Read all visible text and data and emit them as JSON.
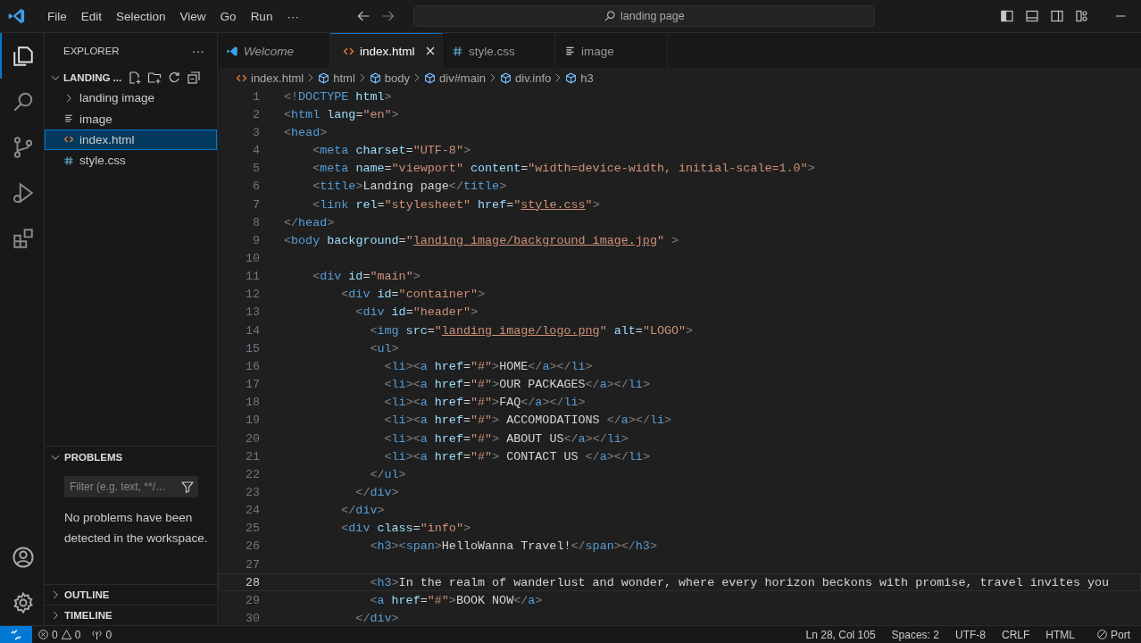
{
  "title_bar": {
    "menu": [
      "File",
      "Edit",
      "Selection",
      "View",
      "Go",
      "Run",
      "···"
    ],
    "search": {
      "value": "landing page"
    }
  },
  "activity_bar": [
    {
      "kind": "explorer",
      "selected": true
    },
    {
      "kind": "search",
      "selected": false
    },
    {
      "kind": "source-control",
      "selected": false
    },
    {
      "kind": "run",
      "selected": false
    },
    {
      "kind": "extensions",
      "selected": false
    }
  ],
  "activity_bar_bottom": [
    {
      "kind": "account"
    },
    {
      "kind": "settings"
    }
  ],
  "sidebar": {
    "title": "EXPLORER",
    "more": "···",
    "folder": {
      "name": "LANDING ...",
      "expanded": true,
      "items": [
        {
          "kind": "folder",
          "name": "landing image",
          "expanded": false,
          "selected": false
        },
        {
          "kind": "text",
          "name": "image",
          "selected": false
        },
        {
          "kind": "html",
          "name": "index.html",
          "selected": true
        },
        {
          "kind": "css",
          "name": "style.css",
          "selected": false
        }
      ]
    },
    "problems": {
      "title": "PROBLEMS",
      "expanded": true,
      "filter": {
        "placeholder": "Filter (e.g. text, **/…"
      },
      "message": "No problems have been detected in the workspace."
    },
    "sections": [
      {
        "title": "OUTLINE",
        "expanded": false
      },
      {
        "title": "TIMELINE",
        "expanded": false
      }
    ]
  },
  "tabs": [
    {
      "kind": "welcome",
      "label": "Welcome",
      "preview": true,
      "selected": false
    },
    {
      "kind": "html",
      "label": "index.html",
      "preview": false,
      "selected": true
    },
    {
      "kind": "css",
      "label": "style.css",
      "preview": false,
      "selected": false
    },
    {
      "kind": "text",
      "label": "image",
      "preview": false,
      "selected": false
    }
  ],
  "breadcrumbs": [
    {
      "kind": "file",
      "label": "index.html"
    },
    {
      "kind": "element",
      "label": "html"
    },
    {
      "kind": "element",
      "label": "body"
    },
    {
      "kind": "element",
      "label": "div#main"
    },
    {
      "kind": "element",
      "label": "div.info"
    },
    {
      "kind": "element",
      "label": "h3"
    }
  ],
  "editor": {
    "lines": [
      {
        "number": "1",
        "current": false,
        "tokens": [
          {
            "kind": "bracket",
            "text": "<!"
          },
          {
            "kind": "tag",
            "text": "DOCTYPE"
          },
          {
            "kind": "attr",
            "text": " html"
          },
          {
            "kind": "bracket",
            "text": ">"
          }
        ]
      },
      {
        "number": "2",
        "current": false,
        "tokens": [
          {
            "kind": "bracket",
            "text": "<"
          },
          {
            "kind": "tag",
            "text": "html"
          },
          {
            "kind": "attr",
            "text": " lang"
          },
          {
            "kind": "punct",
            "text": "="
          },
          {
            "kind": "string",
            "text": "\"en\""
          },
          {
            "kind": "bracket",
            "text": ">"
          }
        ]
      },
      {
        "number": "3",
        "current": false,
        "tokens": [
          {
            "kind": "bracket",
            "text": "<"
          },
          {
            "kind": "tag",
            "text": "head"
          },
          {
            "kind": "bracket",
            "text": ">"
          }
        ]
      },
      {
        "number": "4",
        "current": false,
        "tokens": [
          {
            "kind": "bracket",
            "text": "    <"
          },
          {
            "kind": "tag",
            "text": "meta"
          },
          {
            "kind": "attr",
            "text": " charset"
          },
          {
            "kind": "punct",
            "text": "="
          },
          {
            "kind": "string",
            "text": "\"UTF-8\""
          },
          {
            "kind": "bracket",
            "text": ">"
          }
        ]
      },
      {
        "number": "5",
        "current": false,
        "tokens": [
          {
            "kind": "bracket",
            "text": "    <"
          },
          {
            "kind": "tag",
            "text": "meta"
          },
          {
            "kind": "attr",
            "text": " name"
          },
          {
            "kind": "punct",
            "text": "="
          },
          {
            "kind": "string",
            "text": "\"viewport\""
          },
          {
            "kind": "attr",
            "text": " content"
          },
          {
            "kind": "punct",
            "text": "="
          },
          {
            "kind": "string",
            "text": "\"width=device-width, initial-scale=1.0\""
          },
          {
            "kind": "bracket",
            "text": ">"
          }
        ]
      },
      {
        "number": "6",
        "current": false,
        "tokens": [
          {
            "kind": "bracket",
            "text": "    <"
          },
          {
            "kind": "tag",
            "text": "title"
          },
          {
            "kind": "bracket",
            "text": ">"
          },
          {
            "kind": "text",
            "text": "Landing page"
          },
          {
            "kind": "bracket",
            "text": "</"
          },
          {
            "kind": "tag",
            "text": "title"
          },
          {
            "kind": "bracket",
            "text": ">"
          }
        ]
      },
      {
        "number": "7",
        "current": false,
        "tokens": [
          {
            "kind": "bracket",
            "text": "    <"
          },
          {
            "kind": "tag",
            "text": "link"
          },
          {
            "kind": "attr",
            "text": " rel"
          },
          {
            "kind": "punct",
            "text": "="
          },
          {
            "kind": "string",
            "text": "\"stylesheet\""
          },
          {
            "kind": "attr",
            "text": " href"
          },
          {
            "kind": "punct",
            "text": "="
          },
          {
            "kind": "string",
            "text": "\""
          },
          {
            "kind": "link",
            "text": "style.css"
          },
          {
            "kind": "string",
            "text": "\""
          },
          {
            "kind": "bracket",
            "text": ">"
          }
        ]
      },
      {
        "number": "8",
        "current": false,
        "tokens": [
          {
            "kind": "bracket",
            "text": "</"
          },
          {
            "kind": "tag",
            "text": "head"
          },
          {
            "kind": "bracket",
            "text": ">"
          }
        ]
      },
      {
        "number": "9",
        "current": false,
        "tokens": [
          {
            "kind": "bracket",
            "text": "<"
          },
          {
            "kind": "tag",
            "text": "body"
          },
          {
            "kind": "attr",
            "text": " background"
          },
          {
            "kind": "punct",
            "text": "="
          },
          {
            "kind": "string",
            "text": "\""
          },
          {
            "kind": "link",
            "text": "landing image/background image.jpg"
          },
          {
            "kind": "string",
            "text": "\""
          },
          {
            "kind": "bracket",
            "text": " >"
          }
        ]
      },
      {
        "number": "10",
        "current": false
      },
      {
        "number": "11",
        "current": false,
        "tokens": [
          {
            "kind": "bracket",
            "text": "    <"
          },
          {
            "kind": "tag",
            "text": "div"
          },
          {
            "kind": "attr",
            "text": " id"
          },
          {
            "kind": "punct",
            "text": "="
          },
          {
            "kind": "string",
            "text": "\"main\""
          },
          {
            "kind": "bracket",
            "text": ">"
          }
        ]
      },
      {
        "number": "12",
        "current": false,
        "tokens": [
          {
            "kind": "bracket",
            "text": "        <"
          },
          {
            "kind": "tag",
            "text": "div"
          },
          {
            "kind": "attr",
            "text": " id"
          },
          {
            "kind": "punct",
            "text": "="
          },
          {
            "kind": "string",
            "text": "\"container\""
          },
          {
            "kind": "bracket",
            "text": ">"
          }
        ]
      },
      {
        "number": "13",
        "current": false,
        "tokens": [
          {
            "kind": "bracket",
            "text": "          <"
          },
          {
            "kind": "tag",
            "text": "div"
          },
          {
            "kind": "attr",
            "text": " id"
          },
          {
            "kind": "punct",
            "text": "="
          },
          {
            "kind": "string",
            "text": "\"header\""
          },
          {
            "kind": "bracket",
            "text": ">"
          }
        ]
      },
      {
        "number": "14",
        "current": false,
        "tokens": [
          {
            "kind": "bracket",
            "text": "            <"
          },
          {
            "kind": "tag",
            "text": "img"
          },
          {
            "kind": "attr",
            "text": " src"
          },
          {
            "kind": "punct",
            "text": "="
          },
          {
            "kind": "string",
            "text": "\""
          },
          {
            "kind": "link",
            "text": "landing image/logo.png"
          },
          {
            "kind": "string",
            "text": "\""
          },
          {
            "kind": "attr",
            "text": " alt"
          },
          {
            "kind": "punct",
            "text": "="
          },
          {
            "kind": "string",
            "text": "\"LOGO\""
          },
          {
            "kind": "bracket",
            "text": ">"
          }
        ]
      },
      {
        "number": "15",
        "current": false,
        "tokens": [
          {
            "kind": "bracket",
            "text": "            <"
          },
          {
            "kind": "tag",
            "text": "ul"
          },
          {
            "kind": "bracket",
            "text": ">"
          }
        ]
      },
      {
        "number": "16",
        "current": false,
        "tokens": [
          {
            "kind": "bracket",
            "text": "              <"
          },
          {
            "kind": "tag",
            "text": "li"
          },
          {
            "kind": "bracket",
            "text": "><"
          },
          {
            "kind": "tag",
            "text": "a"
          },
          {
            "kind": "attr",
            "text": " href"
          },
          {
            "kind": "punct",
            "text": "="
          },
          {
            "kind": "string",
            "text": "\"#\""
          },
          {
            "kind": "bracket",
            "text": ">"
          },
          {
            "kind": "text",
            "text": "HOME"
          },
          {
            "kind": "bracket",
            "text": "</"
          },
          {
            "kind": "tag",
            "text": "a"
          },
          {
            "kind": "bracket",
            "text": "></"
          },
          {
            "kind": "tag",
            "text": "li"
          },
          {
            "kind": "bracket",
            "text": ">"
          }
        ]
      },
      {
        "number": "17",
        "current": false,
        "tokens": [
          {
            "kind": "bracket",
            "text": "              <"
          },
          {
            "kind": "tag",
            "text": "li"
          },
          {
            "kind": "bracket",
            "text": "><"
          },
          {
            "kind": "tag",
            "text": "a"
          },
          {
            "kind": "attr",
            "text": " href"
          },
          {
            "kind": "punct",
            "text": "="
          },
          {
            "kind": "string",
            "text": "\"#\""
          },
          {
            "kind": "bracket",
            "text": ">"
          },
          {
            "kind": "text",
            "text": "OUR PACKAGES"
          },
          {
            "kind": "bracket",
            "text": "</"
          },
          {
            "kind": "tag",
            "text": "a"
          },
          {
            "kind": "bracket",
            "text": "></"
          },
          {
            "kind": "tag",
            "text": "li"
          },
          {
            "kind": "bracket",
            "text": ">"
          }
        ]
      },
      {
        "number": "18",
        "current": false,
        "tokens": [
          {
            "kind": "bracket",
            "text": "              <"
          },
          {
            "kind": "tag",
            "text": "li"
          },
          {
            "kind": "bracket",
            "text": "><"
          },
          {
            "kind": "tag",
            "text": "a"
          },
          {
            "kind": "attr",
            "text": " href"
          },
          {
            "kind": "punct",
            "text": "="
          },
          {
            "kind": "string",
            "text": "\"#\""
          },
          {
            "kind": "bracket",
            "text": ">"
          },
          {
            "kind": "text",
            "text": "FAQ"
          },
          {
            "kind": "bracket",
            "text": "</"
          },
          {
            "kind": "tag",
            "text": "a"
          },
          {
            "kind": "bracket",
            "text": "></"
          },
          {
            "kind": "tag",
            "text": "li"
          },
          {
            "kind": "bracket",
            "text": ">"
          }
        ]
      },
      {
        "number": "19",
        "current": false,
        "tokens": [
          {
            "kind": "bracket",
            "text": "              <"
          },
          {
            "kind": "tag",
            "text": "li"
          },
          {
            "kind": "bracket",
            "text": "><"
          },
          {
            "kind": "tag",
            "text": "a"
          },
          {
            "kind": "attr",
            "text": " href"
          },
          {
            "kind": "punct",
            "text": "="
          },
          {
            "kind": "string",
            "text": "\"#\""
          },
          {
            "kind": "bracket",
            "text": ">"
          },
          {
            "kind": "text",
            "text": " ACCOMODATIONS "
          },
          {
            "kind": "bracket",
            "text": "</"
          },
          {
            "kind": "tag",
            "text": "a"
          },
          {
            "kind": "bracket",
            "text": "></"
          },
          {
            "kind": "tag",
            "text": "li"
          },
          {
            "kind": "bracket",
            "text": ">"
          }
        ]
      },
      {
        "number": "20",
        "current": false,
        "tokens": [
          {
            "kind": "bracket",
            "text": "              <"
          },
          {
            "kind": "tag",
            "text": "li"
          },
          {
            "kind": "bracket",
            "text": "><"
          },
          {
            "kind": "tag",
            "text": "a"
          },
          {
            "kind": "attr",
            "text": " href"
          },
          {
            "kind": "punct",
            "text": "="
          },
          {
            "kind": "string",
            "text": "\"#\""
          },
          {
            "kind": "bracket",
            "text": ">"
          },
          {
            "kind": "text",
            "text": " ABOUT US"
          },
          {
            "kind": "bracket",
            "text": "</"
          },
          {
            "kind": "tag",
            "text": "a"
          },
          {
            "kind": "bracket",
            "text": "></"
          },
          {
            "kind": "tag",
            "text": "li"
          },
          {
            "kind": "bracket",
            "text": ">"
          }
        ]
      },
      {
        "number": "21",
        "current": false,
        "tokens": [
          {
            "kind": "bracket",
            "text": "              <"
          },
          {
            "kind": "tag",
            "text": "li"
          },
          {
            "kind": "bracket",
            "text": "><"
          },
          {
            "kind": "tag",
            "text": "a"
          },
          {
            "kind": "attr",
            "text": " href"
          },
          {
            "kind": "punct",
            "text": "="
          },
          {
            "kind": "string",
            "text": "\"#\""
          },
          {
            "kind": "bracket",
            "text": ">"
          },
          {
            "kind": "text",
            "text": " CONTACT US "
          },
          {
            "kind": "bracket",
            "text": "</"
          },
          {
            "kind": "tag",
            "text": "a"
          },
          {
            "kind": "bracket",
            "text": "></"
          },
          {
            "kind": "tag",
            "text": "li"
          },
          {
            "kind": "bracket",
            "text": ">"
          }
        ]
      },
      {
        "number": "22",
        "current": false,
        "tokens": [
          {
            "kind": "bracket",
            "text": "            </"
          },
          {
            "kind": "tag",
            "text": "ul"
          },
          {
            "kind": "bracket",
            "text": ">"
          }
        ]
      },
      {
        "number": "23",
        "current": false,
        "tokens": [
          {
            "kind": "bracket",
            "text": "          </"
          },
          {
            "kind": "tag",
            "text": "div"
          },
          {
            "kind": "bracket",
            "text": ">"
          }
        ]
      },
      {
        "number": "24",
        "current": false,
        "tokens": [
          {
            "kind": "bracket",
            "text": "        </"
          },
          {
            "kind": "tag",
            "text": "div"
          },
          {
            "kind": "bracket",
            "text": ">"
          }
        ]
      },
      {
        "number": "25",
        "current": false,
        "tokens": [
          {
            "kind": "bracket",
            "text": "        <"
          },
          {
            "kind": "tag",
            "text": "div"
          },
          {
            "kind": "attr",
            "text": " class"
          },
          {
            "kind": "punct",
            "text": "="
          },
          {
            "kind": "string",
            "text": "\"info\""
          },
          {
            "kind": "bracket",
            "text": ">"
          }
        ]
      },
      {
        "number": "26",
        "current": false,
        "tokens": [
          {
            "kind": "bracket",
            "text": "            <"
          },
          {
            "kind": "tag",
            "text": "h3"
          },
          {
            "kind": "bracket",
            "text": "><"
          },
          {
            "kind": "tag",
            "text": "span"
          },
          {
            "kind": "bracket",
            "text": ">"
          },
          {
            "kind": "text",
            "text": "HelloWanna Travel!"
          },
          {
            "kind": "bracket",
            "text": "</"
          },
          {
            "kind": "tag",
            "text": "span"
          },
          {
            "kind": "bracket",
            "text": "></"
          },
          {
            "kind": "tag",
            "text": "h3"
          },
          {
            "kind": "bracket",
            "text": ">"
          }
        ]
      },
      {
        "number": "27",
        "current": false
      },
      {
        "number": "28",
        "current": true,
        "tokens": [
          {
            "kind": "bracket",
            "text": "            <"
          },
          {
            "kind": "tag",
            "text": "h3"
          },
          {
            "kind": "bracket",
            "text": ">"
          },
          {
            "kind": "text",
            "text": "In the realm of wanderlust and wonder, where every horizon beckons with promise, travel invites you"
          }
        ]
      },
      {
        "number": "29",
        "current": false,
        "tokens": [
          {
            "kind": "bracket",
            "text": "            <"
          },
          {
            "kind": "tag",
            "text": "a"
          },
          {
            "kind": "attr",
            "text": " href"
          },
          {
            "kind": "punct",
            "text": "="
          },
          {
            "kind": "string",
            "text": "\"#\""
          },
          {
            "kind": "bracket",
            "text": ">"
          },
          {
            "kind": "text",
            "text": "BOOK NOW"
          },
          {
            "kind": "bracket",
            "text": "</"
          },
          {
            "kind": "tag",
            "text": "a"
          },
          {
            "kind": "bracket",
            "text": ">"
          }
        ]
      },
      {
        "number": "30",
        "current": false,
        "tokens": [
          {
            "kind": "bracket",
            "text": "          </"
          },
          {
            "kind": "tag",
            "text": "div"
          },
          {
            "kind": "bracket",
            "text": ">"
          }
        ]
      }
    ]
  },
  "status_bar": {
    "errors": "0",
    "warnings": "0",
    "ports": "0",
    "items": [
      "Ln 28, Col 105",
      "Spaces: 2",
      "UTF-8",
      "CRLF",
      "HTML"
    ],
    "port": "Port"
  }
}
